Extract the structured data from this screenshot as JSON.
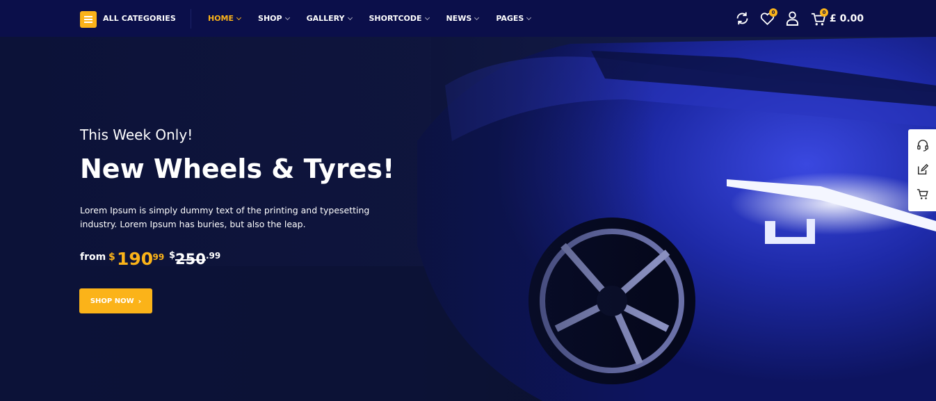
{
  "header": {
    "categories_label": "ALL CATEGORIES",
    "nav": [
      {
        "label": "HOME",
        "active": true
      },
      {
        "label": "SHOP"
      },
      {
        "label": "GALLERY"
      },
      {
        "label": "SHORTCODE"
      },
      {
        "label": "NEWS"
      },
      {
        "label": "PAGES"
      }
    ],
    "icons": [
      "refresh-icon",
      "heart-icon",
      "user-icon",
      "cart-icon"
    ],
    "wishlist_count": "0",
    "cart_count": "0",
    "cart_total": "£ 0.00"
  },
  "hero": {
    "tagline": "This Week Only!",
    "headline": "New Wheels & Tyres!",
    "description": "Lorem Ipsum is simply dummy text of the printing and typesetting industry. Lorem Ipsum has buries, but also the leap.",
    "from_label": "from",
    "new_price": {
      "currency": "$",
      "integer": "190",
      "decimal": ".99"
    },
    "old_price": {
      "currency": "$",
      "integer": "250",
      "decimal": ".99"
    },
    "button_label": "SHOP NOW",
    "button_icon": "chevron-right-icon"
  },
  "side_panel": {
    "icons": [
      "headset-icon",
      "edit-icon",
      "cart-icon"
    ]
  },
  "colors": {
    "accent": "#fbb319",
    "nav_bg": "#0b0f4a",
    "hero_bg": "#0e1556"
  }
}
